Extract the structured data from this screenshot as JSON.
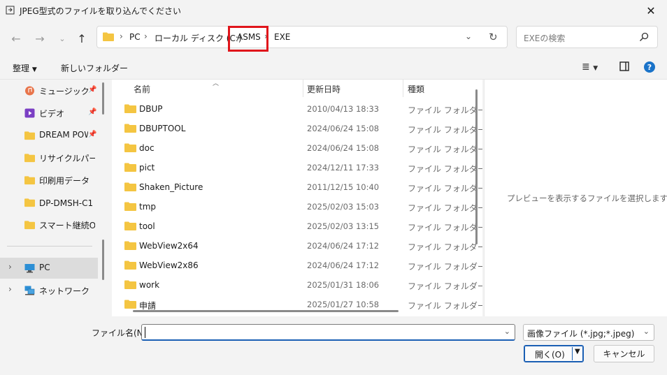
{
  "window": {
    "title": "JPEG型式のファイルを取り込んでください",
    "close": "✕"
  },
  "nav": {
    "breadcrumbs": [
      "PC",
      "ローカル ディスク (C:)",
      "ASMS",
      "EXE"
    ],
    "search_placeholder": "EXEの検索"
  },
  "toolbar": {
    "organize": "整理",
    "new_folder": "新しいフォルダー"
  },
  "sidebar": {
    "quick": [
      {
        "label": "ミュージック",
        "icon": "music-icon",
        "pinned": true
      },
      {
        "label": "ビデオ",
        "icon": "video-icon",
        "pinned": true
      },
      {
        "label": "DREAM POW",
        "icon": "folder-icon",
        "pinned": true
      },
      {
        "label": "リサイクルパーツ",
        "icon": "folder-icon",
        "pinned": false
      },
      {
        "label": "印刷用データ",
        "icon": "folder-icon",
        "pinned": false
      },
      {
        "label": "DP-DMSH-C1（",
        "icon": "folder-icon",
        "pinned": false
      },
      {
        "label": "スマート継続OSS",
        "icon": "folder-icon",
        "pinned": false
      }
    ],
    "tree": [
      {
        "label": "PC",
        "icon": "pc-icon",
        "selected": true
      },
      {
        "label": "ネットワーク",
        "icon": "network-icon",
        "selected": false
      }
    ]
  },
  "filelist": {
    "columns": {
      "name": "名前",
      "date": "更新日時",
      "type": "種類"
    },
    "rows": [
      {
        "name": "DBUP",
        "date": "2010/04/13 18:33",
        "type": "ファイル フォルダー"
      },
      {
        "name": "DBUPTOOL",
        "date": "2024/06/24 15:08",
        "type": "ファイル フォルダー"
      },
      {
        "name": "doc",
        "date": "2024/06/24 15:08",
        "type": "ファイル フォルダー"
      },
      {
        "name": "pict",
        "date": "2024/12/11 17:33",
        "type": "ファイル フォルダー"
      },
      {
        "name": "Shaken_Picture",
        "date": "2011/12/15 10:40",
        "type": "ファイル フォルダー"
      },
      {
        "name": "tmp",
        "date": "2025/02/03 15:03",
        "type": "ファイル フォルダー"
      },
      {
        "name": "tool",
        "date": "2025/02/03 13:15",
        "type": "ファイル フォルダー"
      },
      {
        "name": "WebView2x64",
        "date": "2024/06/24 17:12",
        "type": "ファイル フォルダー"
      },
      {
        "name": "WebView2x86",
        "date": "2024/06/24 17:12",
        "type": "ファイル フォルダー"
      },
      {
        "name": "work",
        "date": "2025/01/31 18:06",
        "type": "ファイル フォルダー"
      },
      {
        "name": "申請",
        "date": "2025/01/27 10:58",
        "type": "ファイル フォルダー"
      }
    ]
  },
  "preview": {
    "text": "プレビューを表示するファイルを選択します。"
  },
  "bottom": {
    "filename_label": "ファイル名(N):",
    "filename_value": "",
    "filetype": "画像ファイル (*.jpg;*.jpeg)",
    "open": "開く(O)",
    "cancel": "キャンセル"
  },
  "colors": {
    "accent": "#1a5fb4",
    "folder": "#f4c542",
    "highlight": "#e0151b"
  }
}
